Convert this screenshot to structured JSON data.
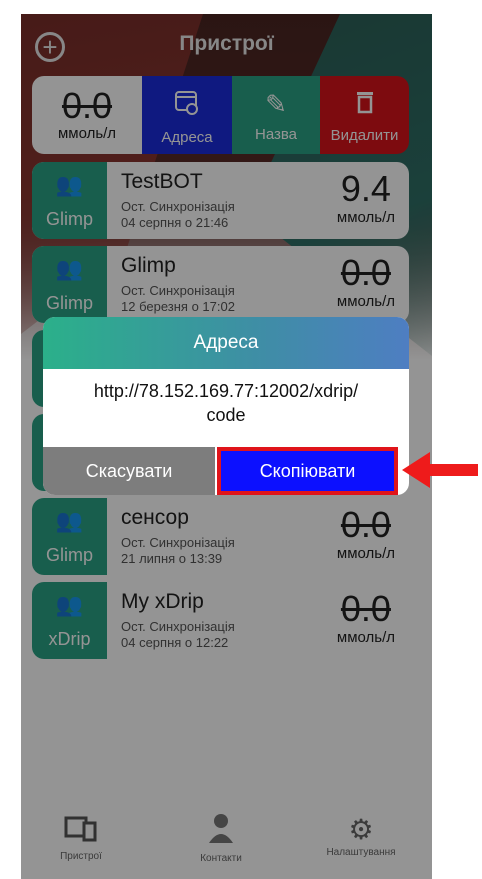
{
  "header": {
    "title": "Пристрої",
    "add_icon": "plus-circle-icon"
  },
  "swipe_row": {
    "value": "0.0",
    "unit": "ммоль/л",
    "actions": [
      {
        "label": "Адреса",
        "icon": "browser-window-icon",
        "color": "#1a2bdc"
      },
      {
        "label": "Назва",
        "icon": "pencil-icon",
        "color": "#2aa385"
      },
      {
        "label": "Видалити",
        "icon": "trash-icon",
        "color": "#d8141a"
      }
    ]
  },
  "devices": [
    {
      "type": "Glimp",
      "name": "TestBOT",
      "sync_label": "Ост. Синхронізація",
      "sync_date": "04 серпня о 21:46",
      "value": "9.4",
      "unit": "ммоль/л",
      "stale": false
    },
    {
      "type": "Glimp",
      "name": "Glimp",
      "sync_label": "Ост. Синхронізація",
      "sync_date": "12 березня о 17:02",
      "value": "0.0",
      "unit": "ммоль/л",
      "stale": true
    },
    {
      "type": "Glimp",
      "name": "сенсор",
      "sync_label": "Ост. Синхронізація",
      "sync_date": "21 липня о 13:39",
      "value": "0.0",
      "unit": "ммоль/л",
      "stale": true
    },
    {
      "type": "xDrip",
      "name": "My xDrip",
      "sync_label": "Ост. Синхронізація",
      "sync_date": "04 серпня о 12:22",
      "value": "0.0",
      "unit": "ммоль/л",
      "stale": true
    }
  ],
  "dialog": {
    "title": "Адреса",
    "address_line1": "http://78.152.169.77:12002/xdrip/",
    "address_line2": "code",
    "cancel_label": "Скасувати",
    "copy_label": "Скопіювати"
  },
  "tabbar": {
    "items": [
      {
        "label": "Пристрої",
        "icon": "devices-icon"
      },
      {
        "label": "Контакти",
        "icon": "doctor-icon"
      },
      {
        "label": "Налаштування",
        "icon": "gear-icon"
      }
    ]
  },
  "colors": {
    "accent_green": "#2aa385",
    "highlight": "#e0141a",
    "copy_button": "#0c10ff"
  }
}
